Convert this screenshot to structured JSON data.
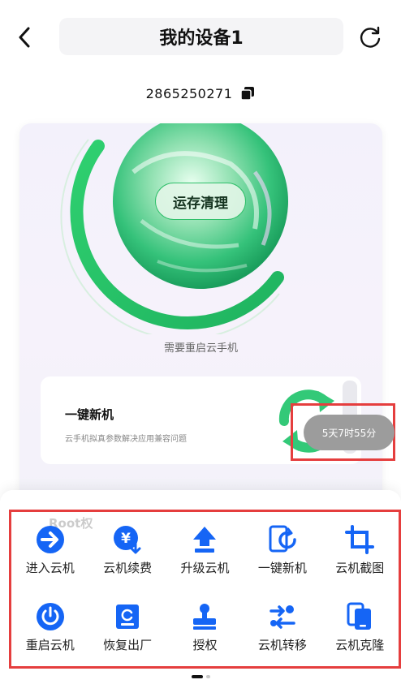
{
  "header": {
    "title": "我的设备1",
    "back_icon": "chevron-left-icon",
    "refresh_icon": "refresh-icon"
  },
  "device": {
    "id": "2865250271",
    "copy_icon": "copy-icon"
  },
  "orb": {
    "clean_label": "运存清理"
  },
  "restart_hint": "需要重启云手机",
  "feature": {
    "title": "一键新机",
    "description": "云手机拟真参数解决应用兼容问题"
  },
  "timer": {
    "label": "5天7时55分"
  },
  "ghost_row": {
    "label": "Root权"
  },
  "actions": [
    {
      "label": "进入云机",
      "icon": "arrow-right-circle-icon"
    },
    {
      "label": "云机续费",
      "icon": "yen-renew-icon"
    },
    {
      "label": "升级云机",
      "icon": "upload-arrow-icon"
    },
    {
      "label": "一键新机",
      "icon": "phone-refresh-icon"
    },
    {
      "label": "云机截图",
      "icon": "crop-icon"
    },
    {
      "label": "重启云机",
      "icon": "power-icon"
    },
    {
      "label": "恢复出厂",
      "icon": "restore-device-icon"
    },
    {
      "label": "授权",
      "icon": "stamp-icon"
    },
    {
      "label": "云机转移",
      "icon": "transfer-icon"
    },
    {
      "label": "云机克隆",
      "icon": "clone-icon"
    }
  ],
  "colors": {
    "accent": "#1565f5",
    "highlight": "#e53e3e",
    "orb_green": "#2fbf6a",
    "timer_bg": "#9c9c9c"
  },
  "pagination": {
    "current": 1,
    "total": 2
  }
}
